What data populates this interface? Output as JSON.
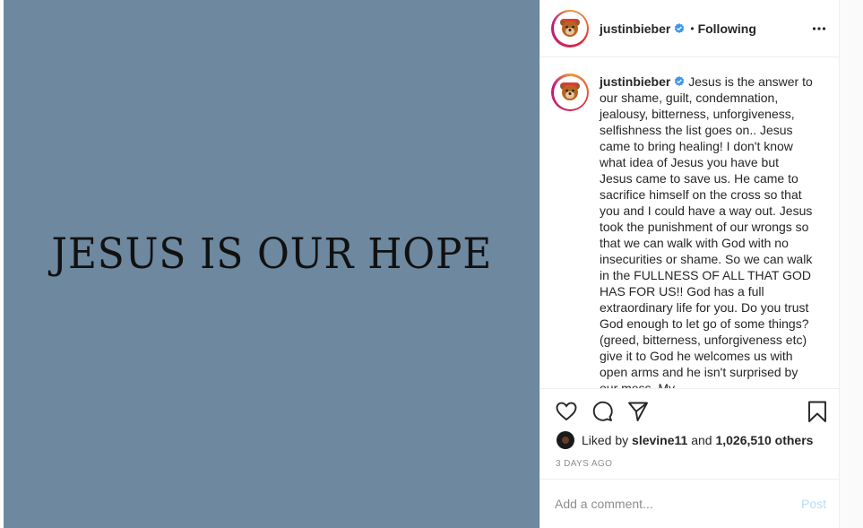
{
  "post_image": {
    "text": "JESUS IS OUR HOPE",
    "background_color": "#6d889f"
  },
  "header": {
    "username": "justinbieber",
    "separator": "•",
    "follow_status": "Following",
    "avatar_icon": "bear-avatar-icon",
    "more_icon": "more-options-icon"
  },
  "caption": {
    "username": "justinbieber",
    "text": "Jesus is the answer to our shame, guilt, condemnation, jealousy, bitterness, unforgiveness, selfishness the list goes on.. Jesus came to bring healing! I don't know what idea of Jesus you have but Jesus came to save us. He came to sacrifice himself on the cross so that you and I could have a way out. Jesus took the punishment of our wrongs so that we can walk with God with no insecurities or shame. So we can walk in the FULLNESS OF ALL THAT GOD HAS FOR US!! God has a full extraordinary life for you. Do you trust God enough to let go of some things? (greed, bitterness, unforgiveness etc) give it to God he welcomes us with open arms and he isn't surprised by our mess. My"
  },
  "actions": {
    "like_icon": "heart-icon",
    "comment_icon": "comment-icon",
    "share_icon": "share-icon",
    "save_icon": "bookmark-icon"
  },
  "likes": {
    "prefix": "Liked by",
    "user": "slevine11",
    "conjunction": "and",
    "count": "1,026,510 others"
  },
  "timestamp": "3 DAYS AGO",
  "comment": {
    "placeholder": "Add a comment...",
    "post_label": "Post"
  },
  "colors": {
    "verified": "#3897f0",
    "post_disabled": "#b2dffc",
    "muted": "#8e8e8e"
  }
}
